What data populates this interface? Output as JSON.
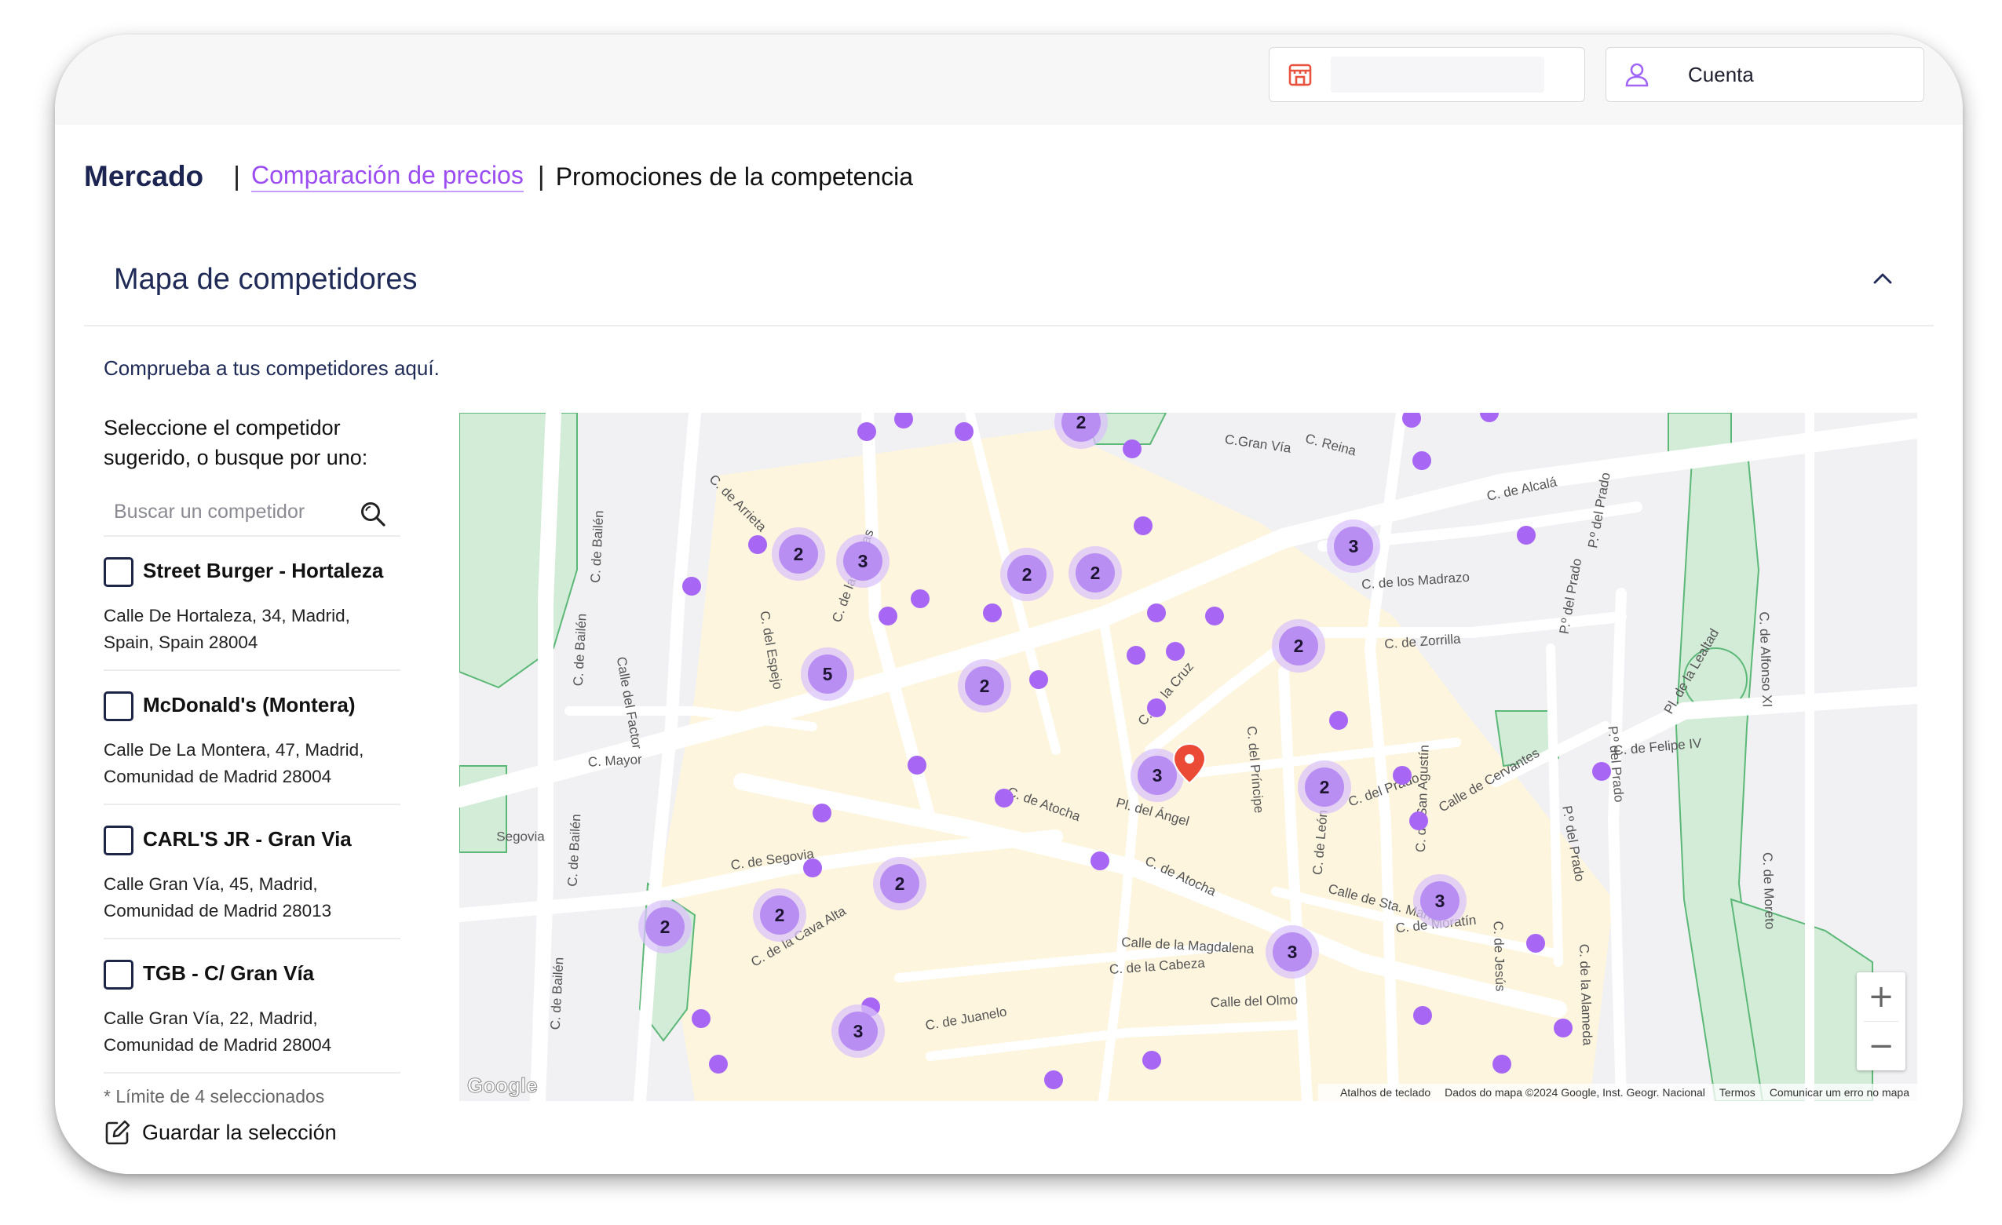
{
  "topbar": {
    "store_icon": "store-icon",
    "account_icon": "user-icon",
    "account_label": "Cuenta",
    "colors": {
      "icon_store": "#e8523f",
      "icon_user": "#a166f5"
    }
  },
  "nav": {
    "brand": "Mercado",
    "separator": "|",
    "tabs": [
      {
        "label": "Comparación de precios",
        "active": true
      },
      {
        "label": "Promociones de la competencia",
        "active": false
      }
    ],
    "colors": {
      "brand": "#1c2451",
      "active_tab": "#9b4df2"
    }
  },
  "panel": {
    "title": "Mapa de competidores",
    "collapse_icon": "chevron-up-icon",
    "subtitle": "Comprueba a tus competidores aquí.",
    "sidebar": {
      "prompt": "Seleccione el competidor sugerido, o busque por uno:",
      "search_placeholder": "Buscar un competidor",
      "search_icon": "search-icon",
      "competitors": [
        {
          "name": "Street Burger - Hortaleza",
          "address": "Calle De Hortaleza, 34, Madrid, Spain, Spain 28004",
          "checked": false
        },
        {
          "name": "McDonald's (Montera)",
          "address": "Calle De La Montera, 47, Madrid, Comunidad de Madrid 28004",
          "checked": false
        },
        {
          "name": "CARL'S JR - Gran Via",
          "address": "Calle Gran Vía, 45, Madrid, Comunidad de Madrid 28013",
          "checked": false
        },
        {
          "name": "TGB - C/ Gran Vía",
          "address": "Calle Gran Vía, 22, Madrid, Comunidad de Madrid 28004",
          "checked": false
        }
      ],
      "limit_note": "* Límite de 4 seleccionados",
      "save_label": "Guardar la selección",
      "save_icon": "edit-icon"
    }
  },
  "map": {
    "streets": [
      "C.Gran Vía",
      "C. de Alcalá",
      "C. de Alcalá",
      "C. de Alcalá",
      "C. de los Madrazo",
      "C. de Zorrilla",
      "C. de Atocha",
      "C. de Atocha",
      "Pl. del Ángel",
      "C. de la Cruz",
      "C. del Príncipe",
      "C. del Prado",
      "Calle de Sta. María",
      "C. de Moratín",
      "Calle de la Magdalena",
      "C. de la Cabeza",
      "Calle del Olmo",
      "C. de Juanelo",
      "C. de Segovia",
      "C. de la Cava Alta",
      "C. Mayor",
      "C. de Bailén",
      "C. de Bailén",
      "C. de Bailén",
      "C. de Bailén",
      "Calle del Factor",
      "C. del Espejo",
      "C. de las Hileras",
      "C. de Arrieta",
      "C. de San Agustín",
      "Calle de Cervantes",
      "C. de León",
      "C. de Jesús",
      "P.º del Prado",
      "P.º del Prado",
      "P.º del Prado",
      "P.º del Prado",
      "C. de Felipe IV",
      "C. de Alfonso XI",
      "C. de Moreto",
      "C. de la Alameda",
      "Pl. de la Lealtad",
      "Segovia",
      "C. Reina"
    ],
    "clusters": [
      {
        "count": "2"
      },
      {
        "count": "2"
      },
      {
        "count": "3"
      },
      {
        "count": "3"
      },
      {
        "count": "2"
      },
      {
        "count": "2"
      },
      {
        "count": "2"
      },
      {
        "count": "5"
      },
      {
        "count": "2"
      },
      {
        "count": "3"
      },
      {
        "count": "2"
      },
      {
        "count": "2"
      },
      {
        "count": "3"
      },
      {
        "count": "3"
      },
      {
        "count": "2"
      },
      {
        "count": "2"
      },
      {
        "count": "3"
      }
    ],
    "zoom_in": "+",
    "zoom_out": "−",
    "logo": "Google",
    "attribution": [
      "Atalhos de teclado",
      "Dados do mapa ©2024 Google, Inst. Geogr. Nacional",
      "Termos",
      "Comunicar um erro no mapa"
    ],
    "colors": {
      "marker": "#a866f5",
      "cluster": "#b98ef3",
      "cluster_halo": "#d9c3fa",
      "pin": "#ea4a36",
      "park": "#d3ecd8",
      "park_line": "#34a853",
      "zone": "#fdf5de",
      "road": "#ffffff"
    }
  }
}
